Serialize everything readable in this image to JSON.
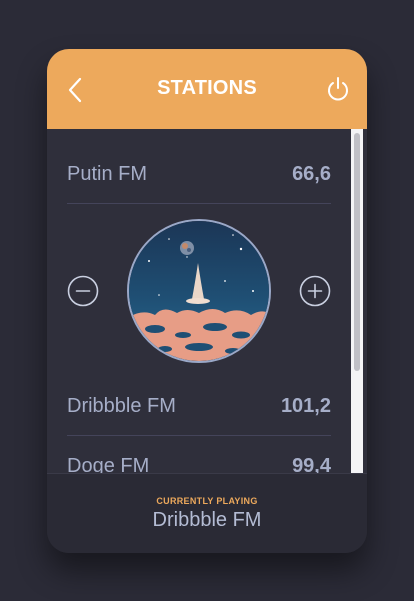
{
  "header": {
    "title": "STATIONS",
    "back_icon": "chevron-left-icon",
    "power_icon": "power-icon",
    "background": "#eda95c"
  },
  "stations": [
    {
      "name": "Putin FM",
      "frequency": "66,6"
    },
    {
      "name": "Dribbble FM",
      "frequency": "101,2"
    },
    {
      "name": "Doge FM",
      "frequency": "99,4"
    }
  ],
  "controls": {
    "minus_icon": "minus-circle-icon",
    "plus_icon": "plus-circle-icon"
  },
  "now_playing": {
    "label": "CURRENTLY PLAYING",
    "station": "Dribbble FM"
  },
  "colors": {
    "accent": "#eda95c",
    "background": "#2b2b37",
    "card": "#2f2f3b",
    "text": "#a6aec8"
  }
}
